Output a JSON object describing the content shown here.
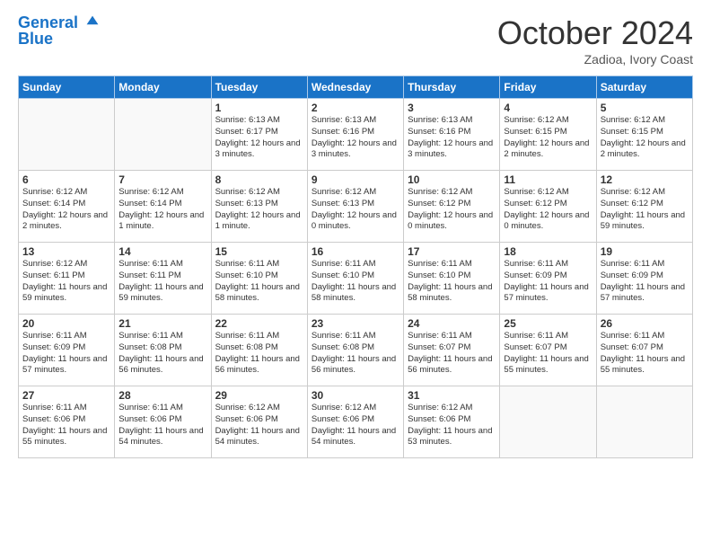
{
  "header": {
    "logo_line1": "General",
    "logo_line2": "Blue",
    "month": "October 2024",
    "location": "Zadioa, Ivory Coast"
  },
  "days_of_week": [
    "Sunday",
    "Monday",
    "Tuesday",
    "Wednesday",
    "Thursday",
    "Friday",
    "Saturday"
  ],
  "weeks": [
    [
      {
        "day": "",
        "info": ""
      },
      {
        "day": "",
        "info": ""
      },
      {
        "day": "1",
        "info": "Sunrise: 6:13 AM\nSunset: 6:17 PM\nDaylight: 12 hours and 3 minutes."
      },
      {
        "day": "2",
        "info": "Sunrise: 6:13 AM\nSunset: 6:16 PM\nDaylight: 12 hours and 3 minutes."
      },
      {
        "day": "3",
        "info": "Sunrise: 6:13 AM\nSunset: 6:16 PM\nDaylight: 12 hours and 3 minutes."
      },
      {
        "day": "4",
        "info": "Sunrise: 6:12 AM\nSunset: 6:15 PM\nDaylight: 12 hours and 2 minutes."
      },
      {
        "day": "5",
        "info": "Sunrise: 6:12 AM\nSunset: 6:15 PM\nDaylight: 12 hours and 2 minutes."
      }
    ],
    [
      {
        "day": "6",
        "info": "Sunrise: 6:12 AM\nSunset: 6:14 PM\nDaylight: 12 hours and 2 minutes."
      },
      {
        "day": "7",
        "info": "Sunrise: 6:12 AM\nSunset: 6:14 PM\nDaylight: 12 hours and 1 minute."
      },
      {
        "day": "8",
        "info": "Sunrise: 6:12 AM\nSunset: 6:13 PM\nDaylight: 12 hours and 1 minute."
      },
      {
        "day": "9",
        "info": "Sunrise: 6:12 AM\nSunset: 6:13 PM\nDaylight: 12 hours and 0 minutes."
      },
      {
        "day": "10",
        "info": "Sunrise: 6:12 AM\nSunset: 6:12 PM\nDaylight: 12 hours and 0 minutes."
      },
      {
        "day": "11",
        "info": "Sunrise: 6:12 AM\nSunset: 6:12 PM\nDaylight: 12 hours and 0 minutes."
      },
      {
        "day": "12",
        "info": "Sunrise: 6:12 AM\nSunset: 6:12 PM\nDaylight: 11 hours and 59 minutes."
      }
    ],
    [
      {
        "day": "13",
        "info": "Sunrise: 6:12 AM\nSunset: 6:11 PM\nDaylight: 11 hours and 59 minutes."
      },
      {
        "day": "14",
        "info": "Sunrise: 6:11 AM\nSunset: 6:11 PM\nDaylight: 11 hours and 59 minutes."
      },
      {
        "day": "15",
        "info": "Sunrise: 6:11 AM\nSunset: 6:10 PM\nDaylight: 11 hours and 58 minutes."
      },
      {
        "day": "16",
        "info": "Sunrise: 6:11 AM\nSunset: 6:10 PM\nDaylight: 11 hours and 58 minutes."
      },
      {
        "day": "17",
        "info": "Sunrise: 6:11 AM\nSunset: 6:10 PM\nDaylight: 11 hours and 58 minutes."
      },
      {
        "day": "18",
        "info": "Sunrise: 6:11 AM\nSunset: 6:09 PM\nDaylight: 11 hours and 57 minutes."
      },
      {
        "day": "19",
        "info": "Sunrise: 6:11 AM\nSunset: 6:09 PM\nDaylight: 11 hours and 57 minutes."
      }
    ],
    [
      {
        "day": "20",
        "info": "Sunrise: 6:11 AM\nSunset: 6:09 PM\nDaylight: 11 hours and 57 minutes."
      },
      {
        "day": "21",
        "info": "Sunrise: 6:11 AM\nSunset: 6:08 PM\nDaylight: 11 hours and 56 minutes."
      },
      {
        "day": "22",
        "info": "Sunrise: 6:11 AM\nSunset: 6:08 PM\nDaylight: 11 hours and 56 minutes."
      },
      {
        "day": "23",
        "info": "Sunrise: 6:11 AM\nSunset: 6:08 PM\nDaylight: 11 hours and 56 minutes."
      },
      {
        "day": "24",
        "info": "Sunrise: 6:11 AM\nSunset: 6:07 PM\nDaylight: 11 hours and 56 minutes."
      },
      {
        "day": "25",
        "info": "Sunrise: 6:11 AM\nSunset: 6:07 PM\nDaylight: 11 hours and 55 minutes."
      },
      {
        "day": "26",
        "info": "Sunrise: 6:11 AM\nSunset: 6:07 PM\nDaylight: 11 hours and 55 minutes."
      }
    ],
    [
      {
        "day": "27",
        "info": "Sunrise: 6:11 AM\nSunset: 6:06 PM\nDaylight: 11 hours and 55 minutes."
      },
      {
        "day": "28",
        "info": "Sunrise: 6:11 AM\nSunset: 6:06 PM\nDaylight: 11 hours and 54 minutes."
      },
      {
        "day": "29",
        "info": "Sunrise: 6:12 AM\nSunset: 6:06 PM\nDaylight: 11 hours and 54 minutes."
      },
      {
        "day": "30",
        "info": "Sunrise: 6:12 AM\nSunset: 6:06 PM\nDaylight: 11 hours and 54 minutes."
      },
      {
        "day": "31",
        "info": "Sunrise: 6:12 AM\nSunset: 6:06 PM\nDaylight: 11 hours and 53 minutes."
      },
      {
        "day": "",
        "info": ""
      },
      {
        "day": "",
        "info": ""
      }
    ]
  ]
}
